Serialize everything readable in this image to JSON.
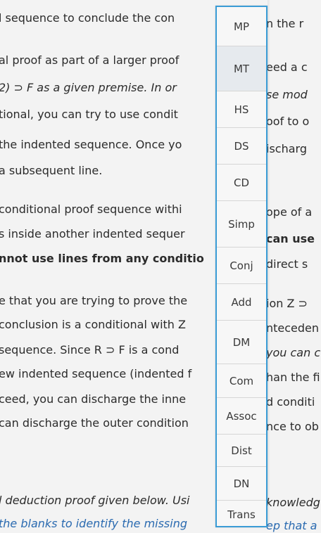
{
  "background_text": {
    "left": [
      "l sequence to conclude the con",
      "al proof as part of a larger proof",
      "2) ⊃ F as a given premise. In or",
      "tional, you can try to use condit",
      "the indented sequence. Once yo",
      "a subsequent line.",
      "conditional proof sequence withi",
      "s inside another indented sequer",
      "nnot use lines from any conditio",
      "e that you are trying to prove the",
      "conclusion is a conditional with Z",
      "sequence. Since R ⊃ F is a cond",
      "ew indented sequence (indented f",
      "ceed, you can discharge the inne",
      "can discharge the outer condition",
      "l deduction proof given below. Usi",
      "the blanks to identify the missing"
    ],
    "right": [
      "n the r",
      "eed a c",
      "se mod",
      "oof to o",
      "ischarg",
      "ope of a",
      "can use",
      "direct s",
      "ion Z ⊃",
      "nteceden",
      "you can c",
      "han the fi",
      "d conditi",
      "nce to ob",
      "knowledg",
      "ep that a"
    ]
  },
  "dropdown": {
    "options": [
      "MP",
      "MT",
      "HS",
      "DS",
      "CD",
      "Simp",
      "Conj",
      "Add",
      "DM",
      "Com",
      "Assoc",
      "Dist",
      "DN",
      "Trans"
    ],
    "highlighted": "MT",
    "accent_color": "#3a9cd6"
  }
}
